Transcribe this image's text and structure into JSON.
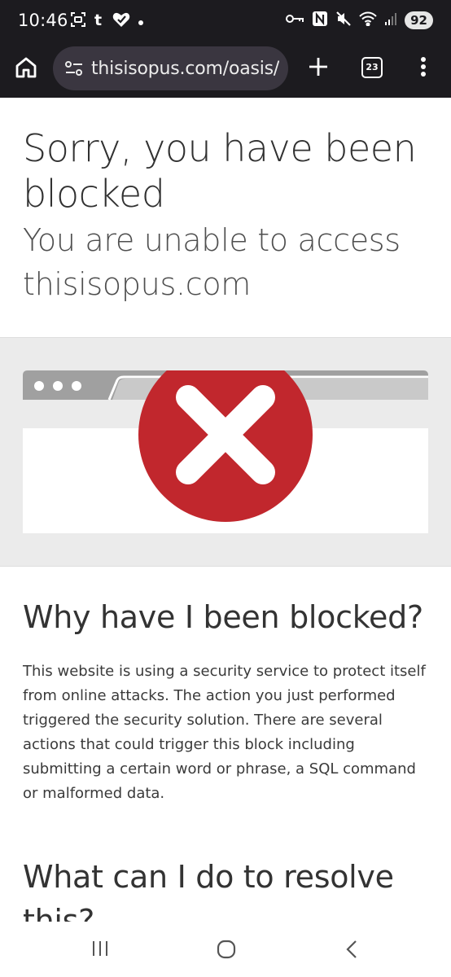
{
  "status_bar": {
    "time": "10:46",
    "battery": "92",
    "left_icons": [
      "screenshot-icon",
      "tumblr-icon",
      "heart-check-icon",
      "dot-icon"
    ],
    "right_icons": [
      "vpn-key-icon",
      "nfc-icon",
      "mute-icon",
      "wifi-icon",
      "signal-icon"
    ]
  },
  "browser": {
    "url": "thisisopus.com/oasis/",
    "tab_count": "23"
  },
  "page": {
    "headline": "Sorry, you have been blocked",
    "subheadline": "You are unable to access thisisopus.com",
    "why_heading": "Why have I been blocked?",
    "why_text": "This website is using a security service to protect itself from online attacks. The action you just performed triggered the security solution. There are several actions that could trigger this block including submitting a certain word or phrase, a SQL command or malformed data.",
    "what_heading": "What can I do to resolve this?"
  },
  "colors": {
    "error_red": "#c1272d",
    "browser_frame_gray": "#a0a0a0",
    "band_gray": "#ebebeb",
    "dark_bar": "#1c1b1f"
  },
  "nav_bar": {
    "buttons": [
      "recents-icon",
      "home-icon",
      "back-icon"
    ]
  }
}
